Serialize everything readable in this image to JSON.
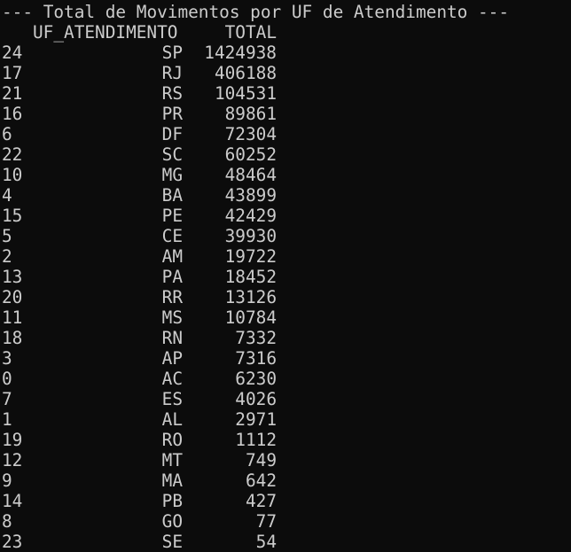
{
  "title": "--- Total de Movimentos por UF de Atendimento ---",
  "columns": {
    "uf": "UF_ATENDIMENTO",
    "total": "TOTAL"
  },
  "rows": [
    {
      "index": "24",
      "uf": "SP",
      "total": "1424938"
    },
    {
      "index": "17",
      "uf": "RJ",
      "total": "406188"
    },
    {
      "index": "21",
      "uf": "RS",
      "total": "104531"
    },
    {
      "index": "16",
      "uf": "PR",
      "total": "89861"
    },
    {
      "index": "6",
      "uf": "DF",
      "total": "72304"
    },
    {
      "index": "22",
      "uf": "SC",
      "total": "60252"
    },
    {
      "index": "10",
      "uf": "MG",
      "total": "48464"
    },
    {
      "index": "4",
      "uf": "BA",
      "total": "43899"
    },
    {
      "index": "15",
      "uf": "PE",
      "total": "42429"
    },
    {
      "index": "5",
      "uf": "CE",
      "total": "39930"
    },
    {
      "index": "2",
      "uf": "AM",
      "total": "19722"
    },
    {
      "index": "13",
      "uf": "PA",
      "total": "18452"
    },
    {
      "index": "20",
      "uf": "RR",
      "total": "13126"
    },
    {
      "index": "11",
      "uf": "MS",
      "total": "10784"
    },
    {
      "index": "18",
      "uf": "RN",
      "total": "7332"
    },
    {
      "index": "3",
      "uf": "AP",
      "total": "7316"
    },
    {
      "index": "0",
      "uf": "AC",
      "total": "6230"
    },
    {
      "index": "7",
      "uf": "ES",
      "total": "4026"
    },
    {
      "index": "1",
      "uf": "AL",
      "total": "2971"
    },
    {
      "index": "19",
      "uf": "RO",
      "total": "1112"
    },
    {
      "index": "12",
      "uf": "MT",
      "total": "749"
    },
    {
      "index": "9",
      "uf": "MA",
      "total": "642"
    },
    {
      "index": "14",
      "uf": "PB",
      "total": "427"
    },
    {
      "index": "8",
      "uf": "GO",
      "total": "77"
    },
    {
      "index": "23",
      "uf": "SE",
      "total": "54"
    }
  ]
}
